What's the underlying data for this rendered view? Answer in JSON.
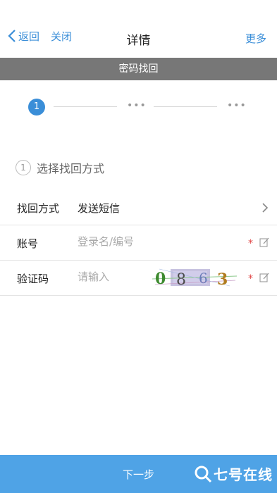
{
  "nav": {
    "back_label": "返回",
    "close_label": "关闭",
    "title": "详情",
    "more_label": "更多"
  },
  "banner": {
    "title": "密码找回"
  },
  "stepper": {
    "step1": "1",
    "step2": "•••",
    "step3": "•••"
  },
  "section": {
    "number": "1",
    "label": "选择找回方式"
  },
  "form": {
    "method": {
      "label": "找回方式",
      "value": "发送短信"
    },
    "account": {
      "label": "账号",
      "placeholder": "登录名/编号",
      "required": "*"
    },
    "captcha": {
      "label": "验证码",
      "placeholder": "请输入",
      "required": "*",
      "image_digits": [
        "0",
        "8",
        "6",
        "3"
      ]
    }
  },
  "footer": {
    "next_label": "下一步",
    "watermark": "七号在线"
  },
  "colors": {
    "accent": "#3a8ed8",
    "banner": "#777777",
    "footer": "#4fa3e6",
    "required": "#e04444"
  }
}
